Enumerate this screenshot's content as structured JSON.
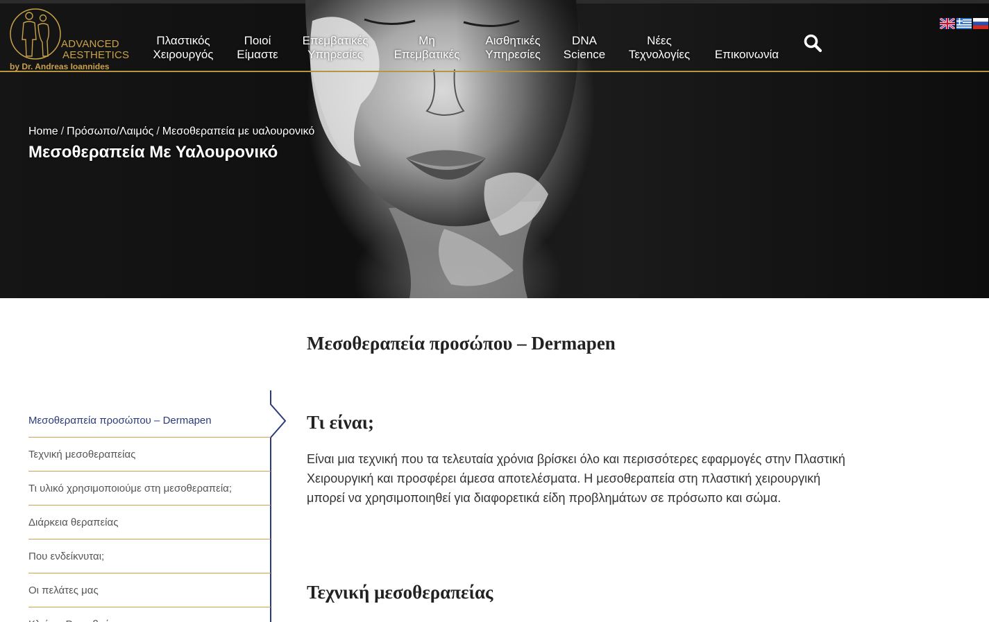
{
  "header": {
    "logo": {
      "line1": "ADVANCED",
      "line2": "AESTHETICS",
      "line3": "by Dr. Andreas Ioannides"
    },
    "nav": [
      {
        "line1": "Πλαστικός",
        "line2": "Χειρουργός"
      },
      {
        "line1": "Ποιοί",
        "line2": "Είμαστε"
      },
      {
        "line1": "Επεμβατικές",
        "line2": "Υπηρεσίες"
      },
      {
        "line1": "Μη",
        "line2": "Επεμβατικές"
      },
      {
        "line1": "Αισθητικές",
        "line2": "Υπηρεσίες"
      },
      {
        "line1": "DNA",
        "line2": "Science"
      },
      {
        "line1": "Νέες",
        "line2": "Τεχνολογίες"
      },
      {
        "line1": "",
        "line2": "Επικοινωνία"
      }
    ],
    "search_icon": "search-icon",
    "flags": [
      "uk-flag",
      "greek-flag",
      "russian-flag"
    ]
  },
  "hero": {
    "breadcrumb": [
      "Home",
      "Πρόσωπο/Λαιμός",
      "Μεσοθεραπεία με υαλουρονικό"
    ],
    "separator": "/",
    "title": "Μεσοθεραπεία Με Υαλουρονικό"
  },
  "main": {
    "title": "Μεσοθεραπεία προσώπου – Dermapen",
    "sidebar": [
      "Μεσοθεραπεία προσώπου – Dermapen",
      "Τεχνική μεσοθεραπείας",
      "Τι υλικό χρησιμοποιούμε στη μεσοθεραπεία;",
      "Διάρκεια θεραπείας",
      "Που ενδείκνυται;",
      "Οι πελάτες μας",
      "Κλείστε Ραντεβού"
    ],
    "sections": [
      {
        "heading": "Τι είναι;",
        "text": "Είναι μια τεχνική που τα τελευταία χρόνια βρίσκει όλο και περισσότερες εφαρμογές στην Πλαστική Χειρουργική και προσφέρει άμεσα αποτελέσματα. Η μεσοθεραπεία στη πλαστική χειρουργική μπορεί να χρησιμοποιηθεί για διαφορετικά είδη προβλημάτων σε πρόσωπο και σώμα."
      },
      {
        "heading": "Τεχνική μεσοθεραπείας"
      }
    ]
  },
  "colors": {
    "gold": "#c9a24a",
    "gold_line": "#b8953f",
    "active_link": "#2c3a7c",
    "sidebar_line": "#2c3a7c"
  }
}
